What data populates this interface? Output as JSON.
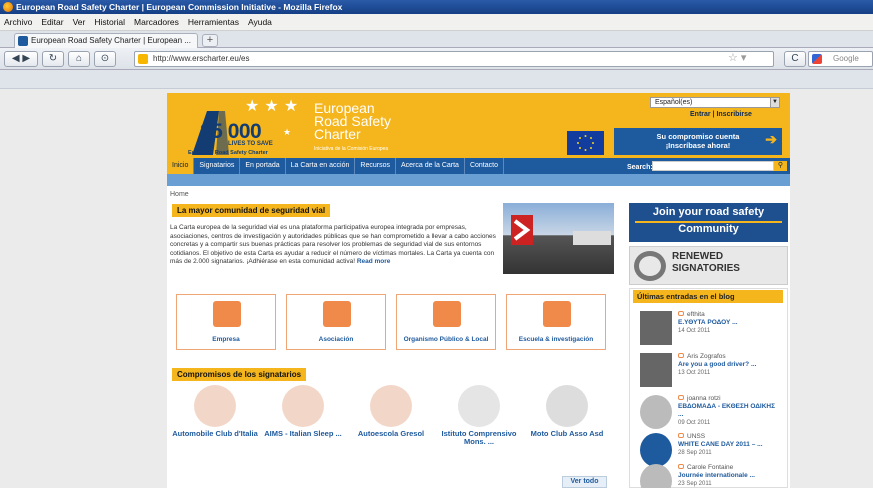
{
  "window": {
    "title": "European Road Safety Charter | European Commission Initiative - Mozilla Firefox"
  },
  "menu": [
    "Archivo",
    "Editar",
    "Ver",
    "Historial",
    "Marcadores",
    "Herramientas",
    "Ayuda"
  ],
  "tab": {
    "label": "European Road Safety Charter | European ...",
    "new_tab": "+"
  },
  "nav": {
    "url": "http://www.erscharter.eu/es",
    "search_engine": "Google"
  },
  "site": {
    "logo": {
      "number": "25 000",
      "tagline": "LIVES TO SAVE",
      "subtitle": "European Road Safety Charter"
    },
    "brand": {
      "line1": "European",
      "line2": "Road Safety",
      "line3": "Charter",
      "sub": "Iniciativa de la Comisión Europea"
    },
    "language": "Español(es)",
    "login": "Entrar | Inscribirse",
    "cta": {
      "line1": "Su compromiso cuenta",
      "line2": "¡Inscríbase ahora!"
    },
    "menu": [
      "Inicio",
      "Signatarios",
      "En portada",
      "La Carta en acción",
      "Recursos",
      "Acerca de la Carta",
      "Contacto"
    ],
    "search_label": "Search:",
    "breadcrumb": "Home",
    "intro_title": "La mayor comunidad de seguridad vial",
    "intro_text": "La Carta europea de la seguridad vial es una plataforma participativa europea integrada por empresas, asociaciones, centros de investigación y autoridades públicas que se han comprometido a llevar a cabo acciones concretas y a compartir sus buenas prácticas para resolver los problemas de seguridad vial de sus entornos cotidianos. El objetivo de esta Carta es ayudar a reducir el número de víctimas mortales. La Carta ya cuenta con más de 2.000 signatarios. ¡Adhiérase en esta comunidad activa!",
    "read_more": "Read more",
    "categories": [
      "Empresa",
      "Asociación",
      "Organismo Público & Local",
      "Escuela & investigación"
    ],
    "commitments_title": "Compromisos de los signatarios",
    "signatories": [
      "Automobile Club d'Italia",
      "AIMS - Italian Sleep ...",
      "Autoescola Gresol",
      "Istituto Comprensivo Mons. ...",
      "Moto Club Asso Asd"
    ],
    "see_all": "Ver todo",
    "join": {
      "line1": "Join your road safety",
      "line2": "Community"
    },
    "renewed": {
      "line1": "RENEWED",
      "line2": "SIGNATORIES"
    },
    "blog_title": "Últimas entradas en el blog",
    "posts": [
      {
        "author": "efthita",
        "title": "Ε.ΥΘΥΤΑ ΡΟΔΟΥ ...",
        "date": "14 Oct 2011"
      },
      {
        "author": "Aris Zografos",
        "title": "Are you a good driver? ...",
        "date": "13 Oct 2011"
      },
      {
        "author": "joanna rotzi",
        "title": "ΕΒΔΟΜΑΔΑ - ΕΚΘΕΣΗ ΟΔΙΚΗΣ ...",
        "date": "09 Oct 2011"
      },
      {
        "author": "UNSS",
        "title": "WHITE CANE DAY 2011 – ...",
        "date": "28 Sep 2011"
      },
      {
        "author": "Carole Fontaine",
        "title": "Journée internationale ...",
        "date": "23 Sep 2011"
      }
    ]
  },
  "colors": {
    "brand_yellow": "#f4b51d",
    "brand_blue": "#1e5a9e",
    "accent_orange": "#f08a4b"
  }
}
